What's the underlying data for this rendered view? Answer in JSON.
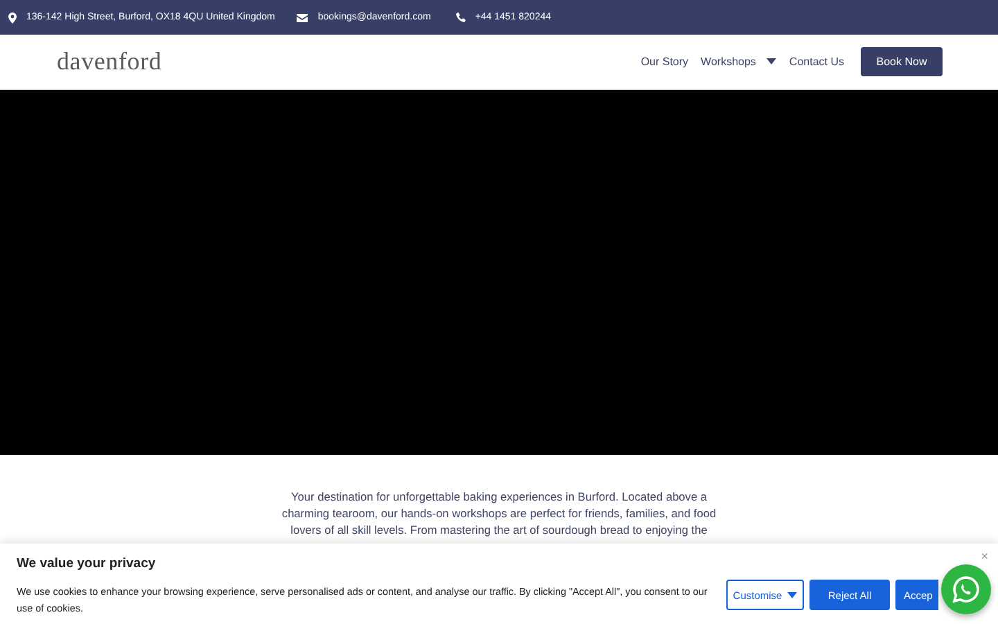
{
  "top_bar": {
    "address": "136-142 High Street, Burford, OX18 4QU United Kingdom",
    "email": "bookings@davenford.com",
    "phone": "+44 1451 820244"
  },
  "header": {
    "logo": "davenford",
    "nav": [
      {
        "label": "Our Story",
        "has_dropdown": false
      },
      {
        "label": "Workshops",
        "has_dropdown": true
      },
      {
        "label": "Contact Us",
        "has_dropdown": false
      }
    ],
    "cta": "Book Now"
  },
  "intro": {
    "lines": [
      "Your destination for unforgettable baking experiences in Burford. Located above a",
      "charming tearoom, our hands-on workshops are perfect for friends, families, and food",
      "lovers of all skill levels. From mastering the art of sourdough bread to enjoying the"
    ]
  },
  "cookie_banner": {
    "title": "We value your privacy",
    "text": "We use cookies to enhance your browsing experience, serve personalised ads or content, and analyse our traffic. By clicking \"Accept All\", you consent to our use of cookies.",
    "close": "×",
    "buttons": [
      {
        "label": "Customise",
        "kind": "outline",
        "has_dropdown": true
      },
      {
        "label": "Reject All",
        "kind": "filled",
        "has_dropdown": false
      },
      {
        "label": "Accep",
        "kind": "filled"
      }
    ]
  }
}
